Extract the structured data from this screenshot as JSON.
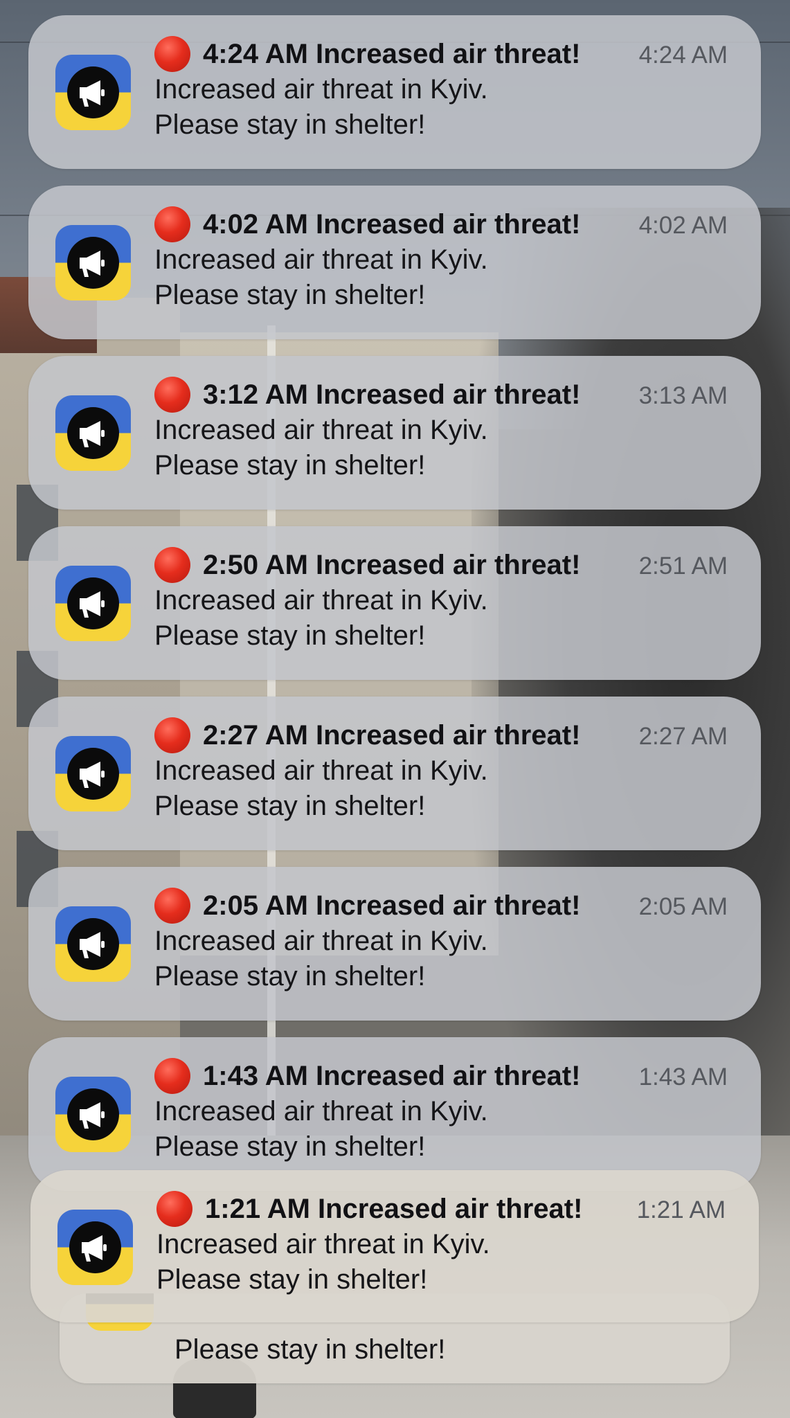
{
  "notifications": [
    {
      "title": "4:24 AM Increased air threat!",
      "time": "4:24 AM",
      "line1": "Increased air threat in Kyiv.",
      "line2": "Please stay in shelter!"
    },
    {
      "title": "4:02 AM Increased air threat!",
      "time": "4:02 AM",
      "line1": "Increased air threat in Kyiv.",
      "line2": "Please stay in shelter!"
    },
    {
      "title": "3:12 AM Increased air threat!",
      "time": "3:13 AM",
      "line1": "Increased air threat in Kyiv.",
      "line2": "Please stay in shelter!"
    },
    {
      "title": "2:50 AM Increased air threat!",
      "time": "2:51 AM",
      "line1": "Increased air threat in Kyiv.",
      "line2": "Please stay in shelter!"
    },
    {
      "title": "2:27 AM Increased air threat!",
      "time": "2:27 AM",
      "line1": "Increased air threat in Kyiv.",
      "line2": "Please stay in shelter!"
    },
    {
      "title": "2:05 AM Increased air threat!",
      "time": "2:05 AM",
      "line1": "Increased air threat in Kyiv.",
      "line2": "Please stay in shelter!"
    },
    {
      "title": "1:43 AM Increased air threat!",
      "time": "1:43 AM",
      "line1": "Increased air threat in Kyiv.",
      "line2": "Please stay in shelter!"
    },
    {
      "title": "1:21 AM Increased air threat!",
      "time": "1:21 AM",
      "line1": "Increased air threat in Kyiv.",
      "line2": "Please stay in shelter!"
    }
  ],
  "stacked_notification": {
    "line2": "Please stay in shelter!"
  },
  "icons": {
    "app": "megaphone-icon",
    "alert_dot": "red-circle-icon"
  },
  "colors": {
    "icon_blue": "#3f6fd0",
    "icon_yellow": "#f6d33a",
    "alert_red": "#e52d1d",
    "card_bg": "#c4c6cc"
  }
}
